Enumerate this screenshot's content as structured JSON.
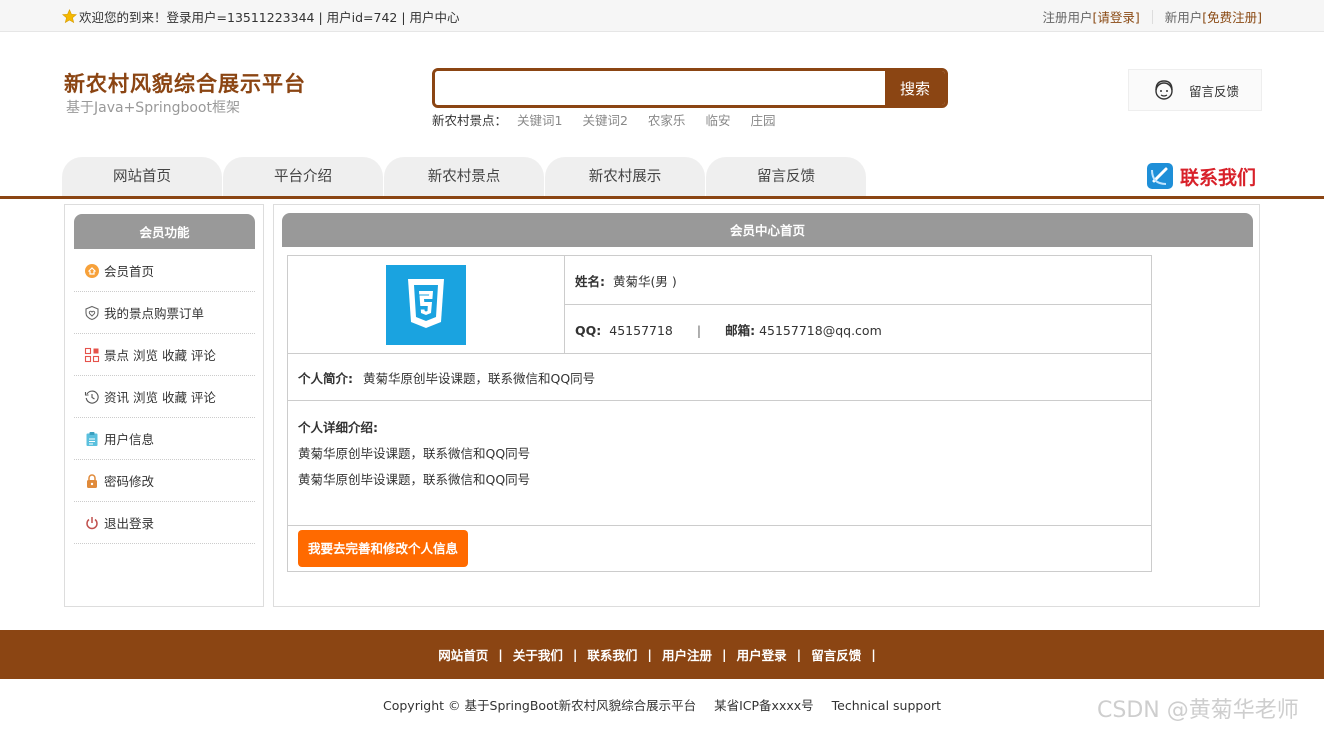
{
  "topbar": {
    "welcome": "欢迎您的到来！",
    "login_info": "登录用户=13511223344 | 用户id=742 | 用户中心",
    "register_user_label": "注册用户",
    "login_link": "[请登录]",
    "new_user_label": "新用户",
    "register_link": "[免费注册]"
  },
  "header": {
    "title": "新农村风貌综合展示平台",
    "subtitle": "基于Java+Springboot框架",
    "search_button": "搜索",
    "search_value": "",
    "hot_label": "新农村景点：",
    "hot_keywords": [
      "关键词1",
      "关键词2",
      "农家乐",
      "临安",
      "庄园"
    ],
    "feedback_label": "留言反馈"
  },
  "nav": {
    "items": [
      "网站首页",
      "平台介绍",
      "新农村景点",
      "新农村展示",
      "留言反馈"
    ],
    "contact": "联系我们"
  },
  "sidebar": {
    "title": "会员功能",
    "items": [
      "会员首页",
      "我的景点购票订单",
      "景点 浏览 收藏 评论",
      "资讯 浏览 收藏 评论",
      "用户信息",
      "密码修改",
      "退出登录"
    ]
  },
  "main": {
    "title": "会员中心首页",
    "name_label": "姓名:",
    "name_value": "黄菊华(男 )",
    "qq_label": "QQ:",
    "qq_value": "45157718",
    "pipe": "|",
    "email_label": "邮箱:",
    "email_value": "45157718@qq.com",
    "intro_label": "个人简介:",
    "intro_value": "黄菊华原创毕设课题，联系微信和QQ同号",
    "detail_label": "个人详细介绍:",
    "detail_lines": [
      "黄菊华原创毕设课题，联系微信和QQ同号",
      "黄菊华原创毕设课题，联系微信和QQ同号"
    ],
    "edit_button": "我要去完善和修改个人信息"
  },
  "footer": {
    "links": [
      "网站首页",
      "关于我们",
      "联系我们",
      "用户注册",
      "用户登录",
      "留言反馈"
    ],
    "sep": "|",
    "copyright": "Copyright © 基于SpringBoot新农村风貌综合展示平台",
    "icp": "某省ICP备xxxx号",
    "support": "Technical support"
  },
  "watermark": "CSDN @黄菊华老师",
  "colors": {
    "brand": "#8b4513",
    "accent_button": "#ff6a00",
    "panel_header": "#999999",
    "contact_text": "#d8212a"
  }
}
